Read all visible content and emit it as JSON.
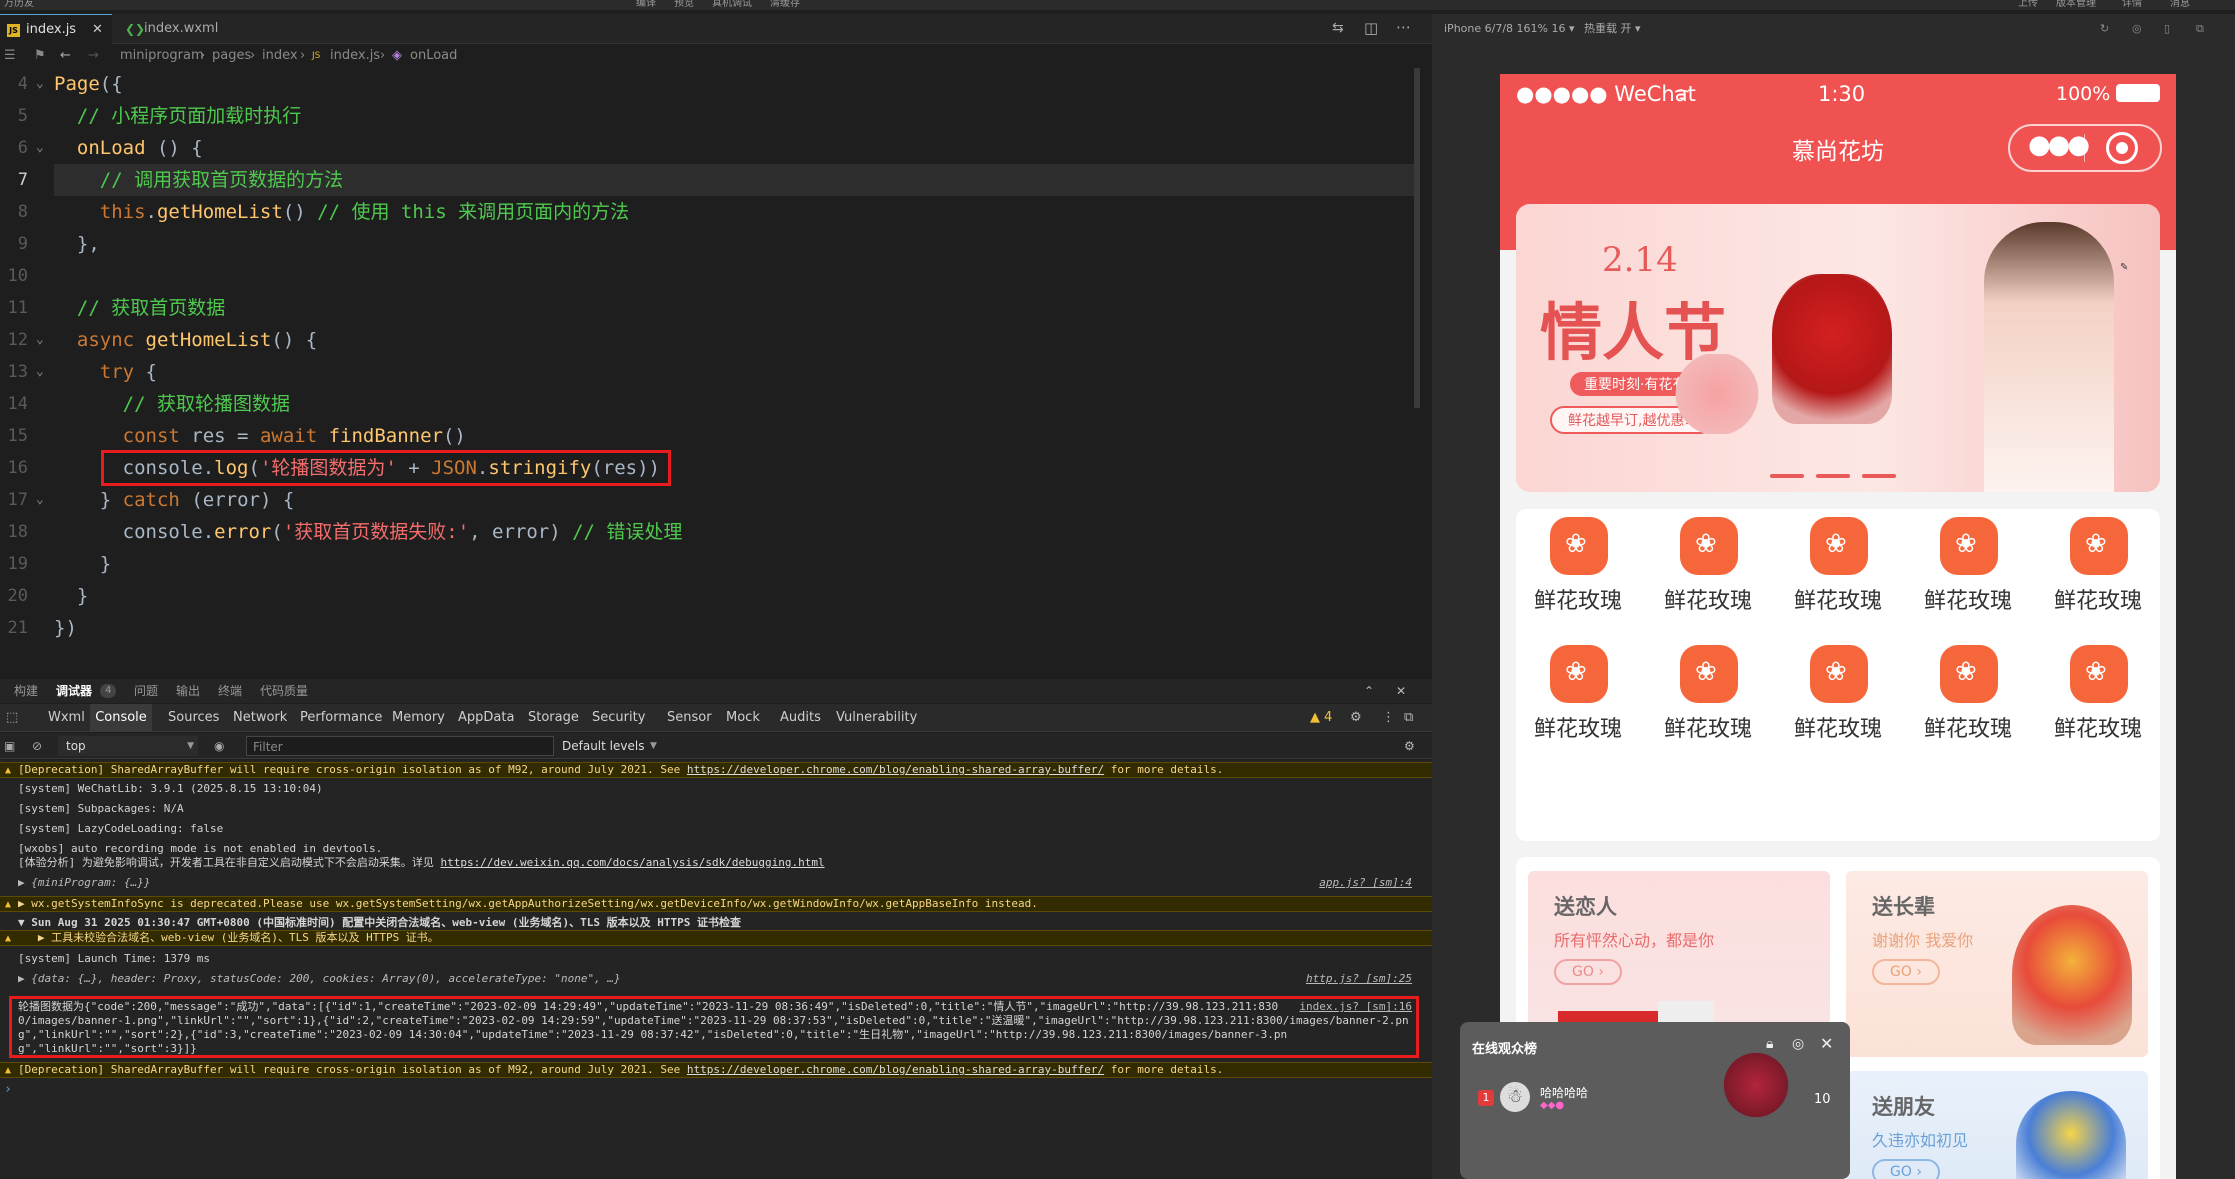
{
  "topbar": {
    "left": "万历友",
    "center_items": [
      "编译",
      "预览",
      "真机调试",
      "清缓存"
    ],
    "right_items": [
      "上传",
      "版本管理",
      "详情",
      "消息"
    ]
  },
  "editor": {
    "tabs": [
      {
        "label": "index.js",
        "icon": "js-file-icon",
        "active": true
      },
      {
        "label": "index.wxml",
        "icon": "wxml-file-icon",
        "active": false
      }
    ],
    "breadcrumb": [
      "miniprogram",
      "pages",
      "index",
      "index.js",
      "onLoad"
    ],
    "code_lines": [
      {
        "n": "4",
        "text": "Page({"
      },
      {
        "n": "5",
        "text": "  // 小程序页面加载时执行"
      },
      {
        "n": "6",
        "text": "  onLoad () {"
      },
      {
        "n": "7",
        "text": "    // 调用获取首页数据的方法"
      },
      {
        "n": "8",
        "text": "    this.getHomeList() // 使用 this 来调用页面内的方法"
      },
      {
        "n": "9",
        "text": "  },"
      },
      {
        "n": "10",
        "text": ""
      },
      {
        "n": "11",
        "text": "  // 获取首页数据"
      },
      {
        "n": "12",
        "text": "  async getHomeList() {"
      },
      {
        "n": "13",
        "text": "    try {"
      },
      {
        "n": "14",
        "text": "      // 获取轮播图数据"
      },
      {
        "n": "15",
        "text": "      const res = await findBanner()"
      },
      {
        "n": "16",
        "text": "      console.log('轮播图数据为' + JSON.stringify(res))"
      },
      {
        "n": "17",
        "text": "    } catch (error) {"
      },
      {
        "n": "18",
        "text": "      console.error('获取首页数据失败:', error) // 错误处理"
      },
      {
        "n": "19",
        "text": "    }"
      },
      {
        "n": "20",
        "text": "  }"
      },
      {
        "n": "21",
        "text": "})"
      }
    ]
  },
  "devtools": {
    "top_tabs": [
      "构建",
      "调试器",
      "4",
      "问题",
      "输出",
      "终端",
      "代码质量"
    ],
    "panel_tabs": [
      "Wxml",
      "Console",
      "Sources",
      "Network",
      "Performance",
      "Memory",
      "AppData",
      "Storage",
      "Security",
      "Sensor",
      "Mock",
      "Audits",
      "Vulnerability"
    ],
    "warn_count": "4",
    "context": "top",
    "filter_placeholder": "Filter",
    "levels": "Default levels",
    "console_lines": [
      {
        "t": "warn",
        "text": "[Deprecation] SharedArrayBuffer will require cross-origin isolation as of M92, around July 2021. See ",
        "link": "https://developer.chrome.com/blog/enabling-shared-array-buffer/",
        "after": " for more details."
      },
      {
        "t": "log",
        "text": "[system] WeChatLib: 3.9.1 (2025.8.15 13:10:04)"
      },
      {
        "t": "log",
        "text": "[system] Subpackages: N/A"
      },
      {
        "t": "log",
        "text": "[system] LazyCodeLoading: false"
      },
      {
        "t": "log",
        "text": "[wxobs] auto recording mode is not enabled in devtools."
      },
      {
        "t": "log",
        "text": "[体验分析] 为避免影响调试，开发者工具在非自定义启动模式下不会启动采集。详见 ",
        "link": "https://dev.weixin.qq.com/docs/analysis/sdk/debugging.html"
      },
      {
        "t": "log",
        "text": "▶ {miniProgram: {…}}",
        "src": "app.js? [sm]:4"
      },
      {
        "t": "warn",
        "text": "▶ wx.getSystemInfoSync is deprecated.Please use wx.getSystemSetting/wx.getAppAuthorizeSetting/wx.getDeviceInfo/wx.getWindowInfo/wx.getAppBaseInfo instead."
      },
      {
        "t": "log",
        "text": "▼ Sun Aug 31 2025 01:30:47 GMT+0800 (中国标准时间) 配置中关闭合法域名、web-view (业务域名)、TLS 版本以及 HTTPS 证书检查"
      },
      {
        "t": "warn",
        "text": "   ▶ 工具未校验合法域名、web-view (业务域名)、TLS 版本以及 HTTPS 证书。"
      },
      {
        "t": "log",
        "text": "[system] Launch Time: 1379 ms"
      },
      {
        "t": "log",
        "text": "▶ {data: {…}, header: Proxy, statusCode: 200, cookies: Array(0), accelerateType: \"none\", …}",
        "src": "http.js? [sm]:25"
      },
      {
        "t": "log",
        "text": "轮播图数据为{\"code\":200,\"message\":\"成功\",\"data\":[{\"id\":1,\"createTime\":\"2023-02-09 14:29:49\",\"updateTime\":\"2023-11-29 08:36:49\",\"isDeleted\":0,\"title\":\"情人节\",\"imageUrl\":\"http://39.98.123.211:830",
        "src": "index.js? [sm]:16"
      },
      {
        "t": "log",
        "text": "0/images/banner-1.png\",\"linkUrl\":\"\",\"sort\":1},{\"id\":2,\"createTime\":\"2023-02-09 14:29:59\",\"updateTime\":\"2023-11-29 08:37:53\",\"isDeleted\":0,\"title\":\"送温暖\",\"imageUrl\":\"http://39.98.123.211:8300/images/banner-2.pn"
      },
      {
        "t": "log",
        "text": "g\",\"linkUrl\":\"\",\"sort\":2},{\"id\":3,\"createTime\":\"2023-02-09 14:30:04\",\"updateTime\":\"2023-11-29 08:37:42\",\"isDeleted\":0,\"title\":\"生日礼物\",\"imageUrl\":\"http://39.98.123.211:8300/images/banner-3.pn"
      },
      {
        "t": "log",
        "text": "g\",\"linkUrl\":\"\",\"sort\":3}]}"
      },
      {
        "t": "warn",
        "text": "[Deprecation] SharedArrayBuffer will require cross-origin isolation as of M92, around July 2021. See ",
        "link": "https://developer.chrome.com/blog/enabling-shared-array-buffer/",
        "after": " for more details."
      }
    ]
  },
  "simulator": {
    "device": "iPhone 6/7/8 161% 16 ▾",
    "hot_reload": "热重载 开 ▾",
    "status": {
      "signal": "●●●●● WeChat",
      "time": "1:30",
      "battery": "100%"
    },
    "title": "慕尚花坊",
    "banner": {
      "date": "2.14",
      "headline": "情人节",
      "tagline": "重要时刻·有花有你",
      "promo": "鲜花越早订,越优惠>"
    },
    "grid_items": [
      "鲜花玫瑰",
      "鲜花玫瑰",
      "鲜花玫瑰",
      "鲜花玫瑰",
      "鲜花玫瑰",
      "鲜花玫瑰",
      "鲜花玫瑰",
      "鲜花玫瑰",
      "鲜花玫瑰",
      "鲜花玫瑰"
    ],
    "cards": [
      {
        "title": "送恋人",
        "subtitle": "所有怦然心动，都是你",
        "go": "GO"
      },
      {
        "title": "送长辈",
        "subtitle": "谢谢你 我爱你",
        "go": "GO"
      },
      {
        "title": "送朋友",
        "subtitle": "久违亦如初见",
        "go": "GO"
      }
    ],
    "overlay": {
      "title": "在线观众榜",
      "rank": "1",
      "user": "哈哈哈哈",
      "count": "10"
    }
  },
  "colors": {
    "brand_red": "#f05252",
    "highlight_box": "#e81c1c",
    "icon_orange": "#f5673b"
  }
}
